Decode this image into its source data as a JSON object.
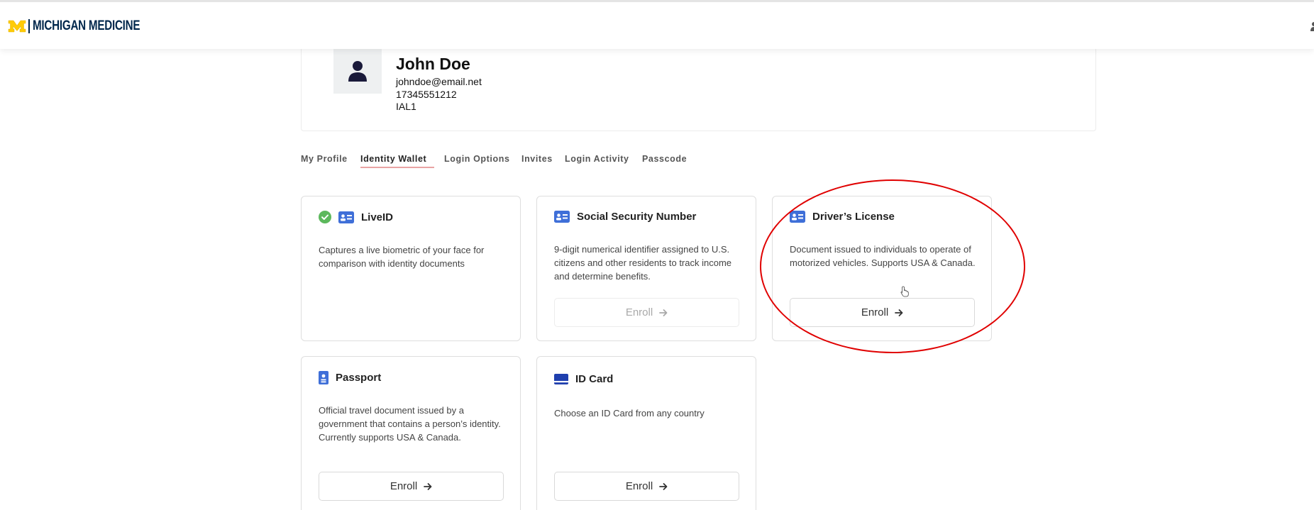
{
  "header": {
    "logo_text": "MICHIGAN MEDICINE"
  },
  "profile": {
    "name": "John Doe",
    "email": "johndoe@email.net",
    "phone": "17345551212",
    "level": "IAL1"
  },
  "tabs": [
    {
      "label": "My Profile",
      "active": false
    },
    {
      "label": "Identity Wallet",
      "active": true
    },
    {
      "label": "Login Options",
      "active": false
    },
    {
      "label": "Invites",
      "active": false
    },
    {
      "label": "Login Activity",
      "active": false
    },
    {
      "label": "Passcode",
      "active": false
    }
  ],
  "cards": [
    {
      "title": "LiveID",
      "description": "Captures a live biometric of your face for comparison with identity documents",
      "verified": true,
      "icon": "id-card-icon"
    },
    {
      "title": "Social Security Number",
      "description": "9-digit numerical identifier assigned to U.S. citizens and other residents to track income and determine benefits.",
      "enroll_label": "Enroll",
      "enroll_disabled": true,
      "icon": "id-card-icon"
    },
    {
      "title": "Driver’s License",
      "description": "Document issued to individuals to operate of motorized vehicles. Supports USA & Canada.",
      "enroll_label": "Enroll",
      "enroll_disabled": false,
      "icon": "id-card-icon"
    },
    {
      "title": "Passport",
      "description": "Official travel document issued by a government that contains a person’s identity. Currently supports USA & Canada.",
      "enroll_label": "Enroll",
      "enroll_disabled": false,
      "icon": "passport-icon"
    },
    {
      "title": "ID Card",
      "description": "Choose an ID Card from any country",
      "enroll_label": "Enroll",
      "enroll_disabled": false,
      "icon": "card-icon"
    }
  ],
  "colors": {
    "brand_navy": "#00274c",
    "brand_maize": "#ffcb05",
    "icon_blue": "#3f6fd8",
    "verified_green": "#5cb85c",
    "highlight_red": "#e00000",
    "tab_underline": "#e9a3a3"
  }
}
